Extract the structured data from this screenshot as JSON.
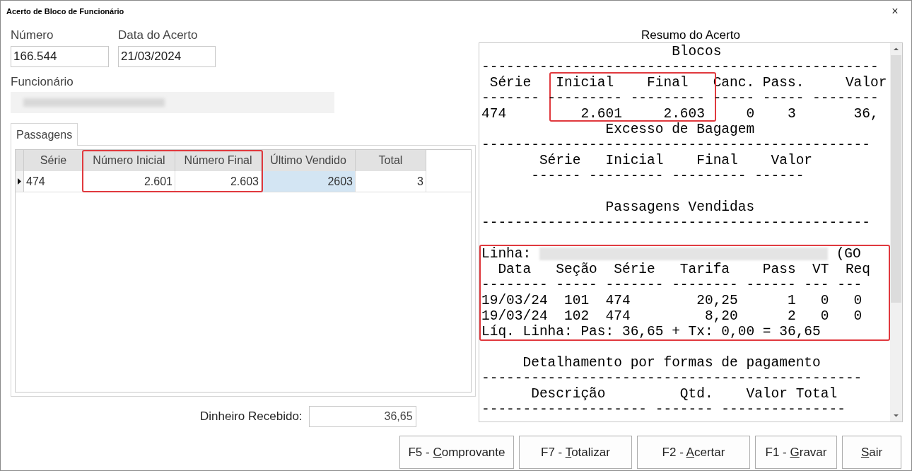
{
  "window": {
    "title": "Acerto de Bloco de Funcionário",
    "close": "×"
  },
  "numero": {
    "label": "Número",
    "value": "166.544"
  },
  "data_acerto": {
    "label": "Data do Acerto",
    "value": "21/03/2024"
  },
  "funcionario": {
    "label": "Funcionário",
    "blurred": true
  },
  "tabs": [
    {
      "label": "Passagens",
      "selected": true
    }
  ],
  "grid": {
    "columns": [
      {
        "label": "Série",
        "highlighted": false
      },
      {
        "label": "Número Inicial",
        "highlighted": true
      },
      {
        "label": "Número Final",
        "highlighted": true
      },
      {
        "label": "Último Vendido",
        "highlighted": false
      },
      {
        "label": "Total",
        "highlighted": false
      }
    ],
    "rows": [
      {
        "current": true,
        "cells": [
          {
            "text": "474",
            "selected": false
          },
          {
            "text": "2.601",
            "selected": false
          },
          {
            "text": "2.603",
            "selected": false
          },
          {
            "text": "2603",
            "selected": true
          },
          {
            "text": "3",
            "selected": false
          }
        ]
      }
    ]
  },
  "dinheiro": {
    "label": "Dinheiro Recebido:",
    "value": "36,65"
  },
  "report": {
    "title": "Resumo do Acerto",
    "lines": [
      {
        "kind": "text",
        "text": "                       Blocos"
      },
      {
        "kind": "text",
        "text": "------------------------------------------------"
      },
      {
        "kind": "text",
        "text": " Série   Inicial    Final   Canc. Pass.     Valor",
        "column_highlight": true
      },
      {
        "kind": "text",
        "text": "------- --------- --------- ----- ----- --------"
      },
      {
        "kind": "text",
        "text": "474         2.601     2.603     0    3       36,"
      },
      {
        "kind": "text",
        "text": "               Excesso de Bagagem"
      },
      {
        "kind": "text",
        "text": "-----------------------------------------------"
      },
      {
        "kind": "text",
        "text": "       Série   Inicial    Final    Valor"
      },
      {
        "kind": "text",
        "text": "      ------ --------- --------- ------"
      },
      {
        "kind": "blank"
      },
      {
        "kind": "text",
        "text": "               Passagens Vendidas"
      },
      {
        "kind": "text",
        "text": "-----------------------------------------------"
      },
      {
        "kind": "blank"
      },
      {
        "kind": "linha",
        "label": "Linha:",
        "suffix": "(GO",
        "highlighted": true
      },
      {
        "kind": "text",
        "text": "  Data   Seção  Série   Tarifa    Pass  VT  Req",
        "highlighted": true
      },
      {
        "kind": "text",
        "text": "-------- ----- ------- -------- ------ --- ---",
        "highlighted": true
      },
      {
        "kind": "text",
        "text": "19/03/24  101  474        20,25      1   0   0",
        "highlighted": true
      },
      {
        "kind": "text",
        "text": "19/03/24  102  474         8,20      2   0   0",
        "highlighted": true
      },
      {
        "kind": "text",
        "text": "Líq. Linha: Pas: 36,65 + Tx: 0,00 = 36,65",
        "highlighted": true
      },
      {
        "kind": "blank"
      },
      {
        "kind": "text",
        "text": "     Detalhamento por formas de pagamento"
      },
      {
        "kind": "text",
        "text": "----------------------------------------------"
      },
      {
        "kind": "text",
        "text": "      Descrição         Qtd.    Valor Total"
      },
      {
        "kind": "text",
        "text": "-------------------- ------- ---------------"
      }
    ]
  },
  "buttons": [
    {
      "prefix": "F5 - ",
      "mnemonic": "C",
      "rest": "omprovante"
    },
    {
      "prefix": "F7 - ",
      "mnemonic": "T",
      "rest": "otalizar"
    },
    {
      "prefix": "F2 - ",
      "mnemonic": "A",
      "rest": "certar"
    },
    {
      "prefix": "F1 - ",
      "mnemonic": "G",
      "rest": "ravar"
    },
    {
      "mnemonic": "S",
      "rest": "air"
    }
  ]
}
